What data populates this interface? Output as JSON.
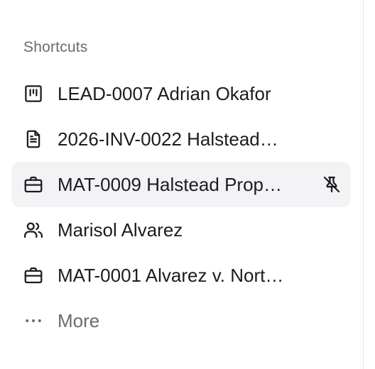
{
  "shortcuts": {
    "title": "Shortcuts",
    "items": [
      {
        "label": "LEAD-0007 Adrian Okafor",
        "icon": "kanban-icon"
      },
      {
        "label": "2026-INV-0022 Halstead…",
        "icon": "document-icon"
      },
      {
        "label": "MAT-0009 Halstead Prop…",
        "icon": "briefcase-icon",
        "active": true,
        "action_icon": "unpin-icon"
      },
      {
        "label": "Marisol Alvarez",
        "icon": "people-icon"
      },
      {
        "label": "MAT-0001 Alvarez v. Nort…",
        "icon": "briefcase-icon"
      }
    ],
    "more_label": "More"
  },
  "colors": {
    "text": "#1c1c1f",
    "muted": "#6b6b6f",
    "active_bg": "#f3f3f5"
  }
}
